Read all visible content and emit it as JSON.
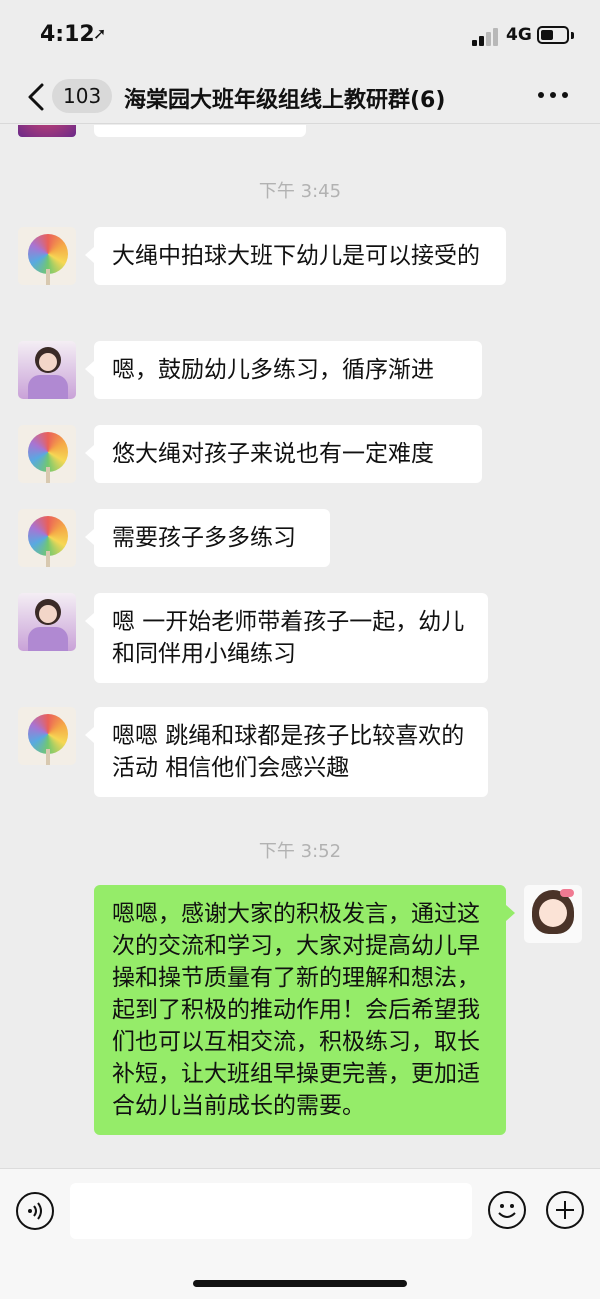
{
  "status_bar": {
    "time": "4:12",
    "location_icon": "location-arrow-icon",
    "network": "4G",
    "battery_icon": "battery-icon"
  },
  "nav": {
    "back_icon": "chevron-left-icon",
    "unread_count": "103",
    "title": "海棠园大班年级组线上教研群(6)",
    "more_icon": "more-dots-icon"
  },
  "messages": {
    "timestamp_1": "下午 3:45",
    "m1": "大绳中拍球大班下幼儿是可以接受的",
    "m2": "嗯，鼓励幼儿多练习，循序渐进",
    "m3": "悠大绳对孩子来说也有一定难度",
    "m4": "需要孩子多多练习",
    "m5": "嗯 一开始老师带着孩子一起，幼儿和同伴用小绳练习",
    "m6": "嗯嗯 跳绳和球都是孩子比较喜欢的活动 相信他们会感兴趣",
    "timestamp_2": "下午 3:52",
    "m7": "嗯嗯，感谢大家的积极发言，通过这次的交流和学习，大家对提高幼儿早操和操节质量有了新的理解和想法，起到了积极的推动作用！会后希望我们也可以互相交流，积极练习，取长补短，让大班组早操更完善，更加适合幼儿当前成长的需要。"
  },
  "input_bar": {
    "voice_icon": "voice-icon",
    "emoji_icon": "emoji-icon",
    "plus_icon": "plus-icon"
  },
  "colors": {
    "background": "#ededed",
    "my_bubble": "#95ec69",
    "other_bubble": "#ffffff",
    "timestamp": "#b2b2b2"
  }
}
